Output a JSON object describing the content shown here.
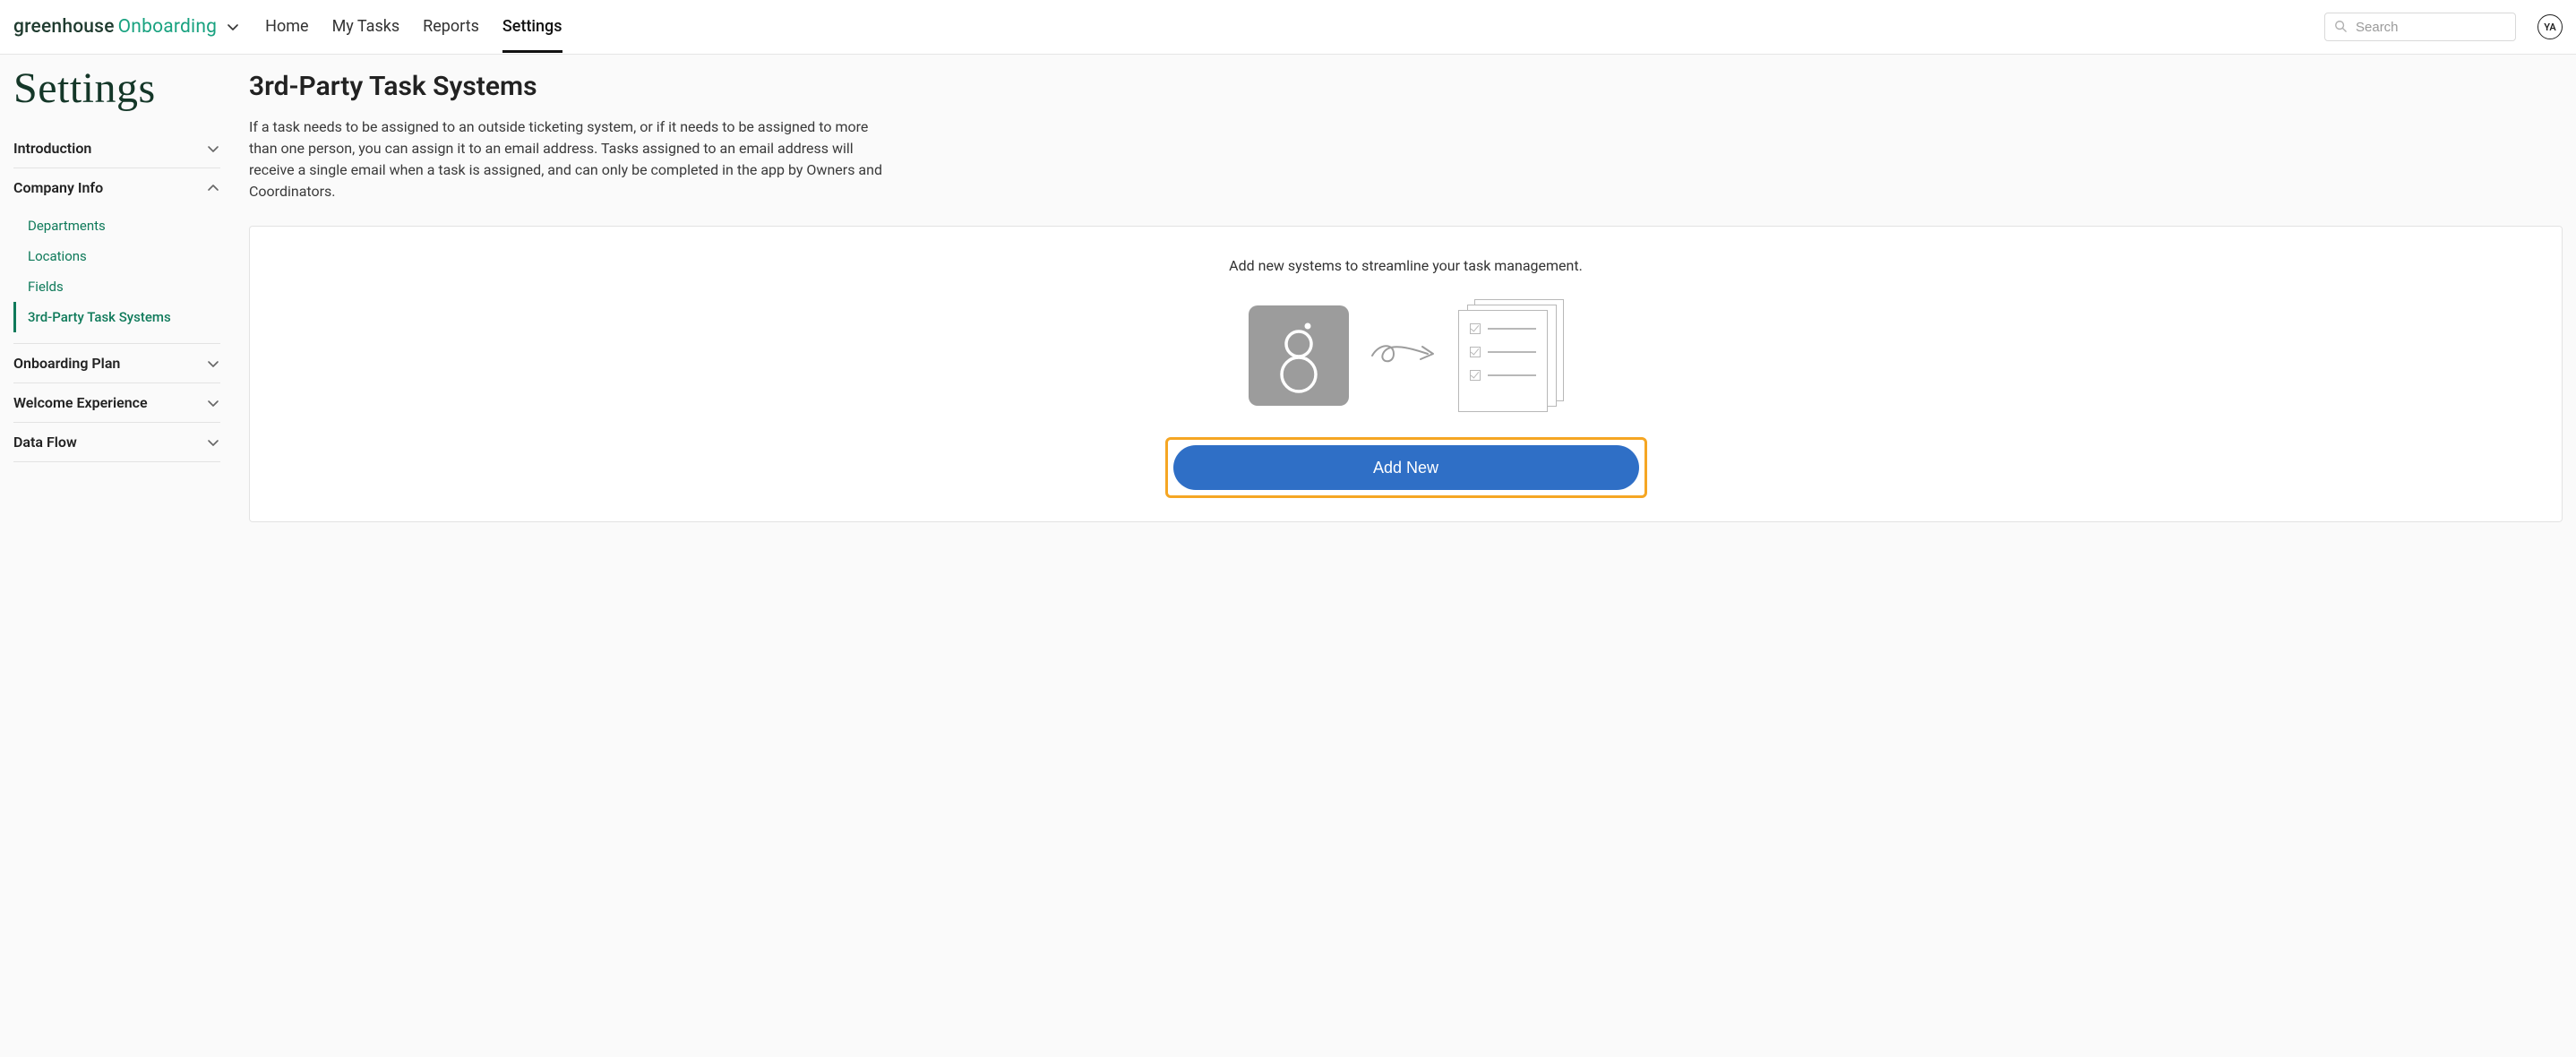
{
  "brand": {
    "part1": "greenhouse",
    "part2": "Onboarding"
  },
  "nav": {
    "items": [
      {
        "label": "Home"
      },
      {
        "label": "My Tasks"
      },
      {
        "label": "Reports"
      },
      {
        "label": "Settings"
      }
    ],
    "active_index": 3
  },
  "search": {
    "placeholder": "Search"
  },
  "user": {
    "initials": "YA"
  },
  "page_title": "Settings",
  "sidebar": {
    "sections": [
      {
        "label": "Introduction",
        "expanded": false
      },
      {
        "label": "Company Info",
        "expanded": true,
        "items": [
          {
            "label": "Departments"
          },
          {
            "label": "Locations"
          },
          {
            "label": "Fields"
          },
          {
            "label": "3rd-Party Task Systems",
            "active": true
          }
        ]
      },
      {
        "label": "Onboarding Plan",
        "expanded": false
      },
      {
        "label": "Welcome Experience",
        "expanded": false
      },
      {
        "label": "Data Flow",
        "expanded": false
      }
    ]
  },
  "content": {
    "heading": "3rd-Party Task Systems",
    "description": "If a task needs to be assigned to an outside ticketing system, or if it needs to be assigned to more than one person, you can assign it to an email address. Tasks assigned to an email address will receive a single email when a task is assigned, and can only be completed in the app by Owners and Coordinators.",
    "hint": "Add new systems to streamline your task management.",
    "add_label": "Add New"
  },
  "colors": {
    "brand_green": "#19a280",
    "link_green": "#0f7a5a",
    "highlight_orange": "#f5a623",
    "primary_blue": "#2f6fc6"
  }
}
